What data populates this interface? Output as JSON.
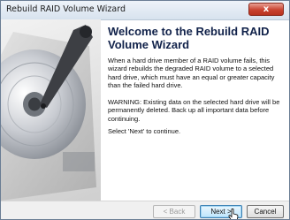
{
  "window": {
    "title": "Rebuild RAID Volume Wizard",
    "close_glyph": "x"
  },
  "content": {
    "heading": "Welcome to the Rebuild RAID\nVolume Wizard",
    "paragraph1": "When a hard drive member of a RAID volume fails, this wizard rebuilds the degraded RAID volume to a selected hard drive, which must have an equal or greater capacity than the failed hard drive.",
    "paragraph2": "WARNING: Existing data on the selected hard drive will be permanently deleted. Back up all important data before continuing.",
    "paragraph3": "Select 'Next' to continue."
  },
  "buttons": {
    "back": "< Back",
    "next": "Next >",
    "cancel": "Cancel"
  },
  "icons": {
    "side_image": "hard-drive-icon",
    "cursor": "mouse-pointer-icon"
  },
  "colors": {
    "heading": "#11224a",
    "default_button": "#bee6fd",
    "close_button": "#c94330"
  }
}
